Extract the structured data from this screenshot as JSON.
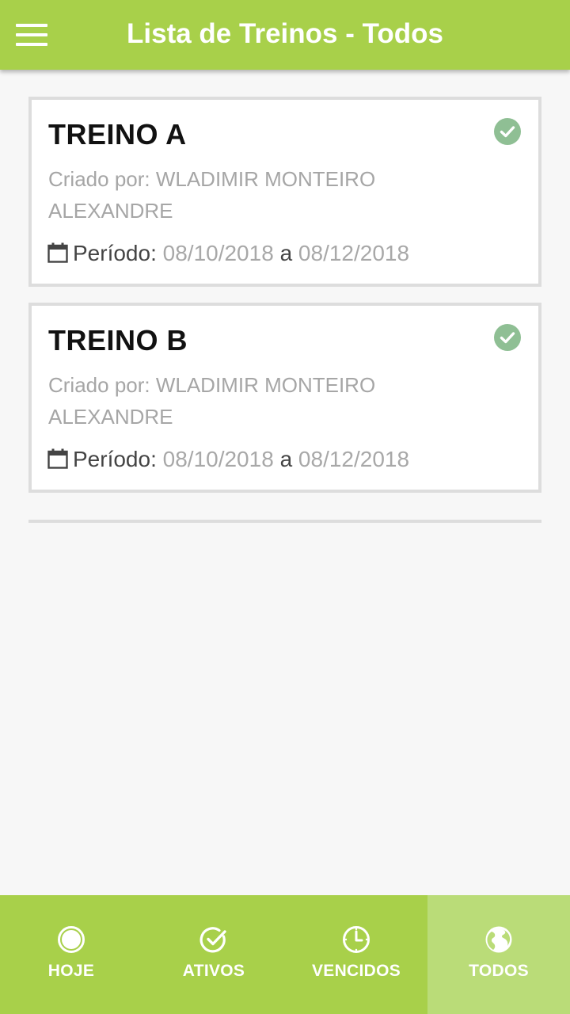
{
  "header": {
    "title": "Lista de Treinos - Todos",
    "menu_icon": "hamburger-menu-icon"
  },
  "workouts": [
    {
      "title": "TREINO A",
      "creator": "Criado por: WLADIMIR MONTEIRO ALEXANDRE",
      "period_label": "Período:",
      "start_date": "08/10/2018",
      "separator": "a",
      "end_date": "08/12/2018",
      "status_icon": "check-circle-icon"
    },
    {
      "title": "TREINO B",
      "creator": "Criado por: WLADIMIR MONTEIRO ALEXANDRE",
      "period_label": "Período:",
      "start_date": "08/10/2018",
      "separator": "a",
      "end_date": "08/12/2018",
      "status_icon": "check-circle-icon"
    }
  ],
  "bottom_nav": {
    "items": [
      {
        "label": "HOJE",
        "icon": "circle-icon",
        "active": false
      },
      {
        "label": "ATIVOS",
        "icon": "check-circle-outline-icon",
        "active": false
      },
      {
        "label": "VENCIDOS",
        "icon": "clock-icon",
        "active": false
      },
      {
        "label": "TODOS",
        "icon": "globe-icon",
        "active": true
      }
    ]
  },
  "colors": {
    "primary": "#a8d04a",
    "active_tab": "#badc78",
    "check_icon": "#8fbf94",
    "background": "#f7f7f7"
  }
}
